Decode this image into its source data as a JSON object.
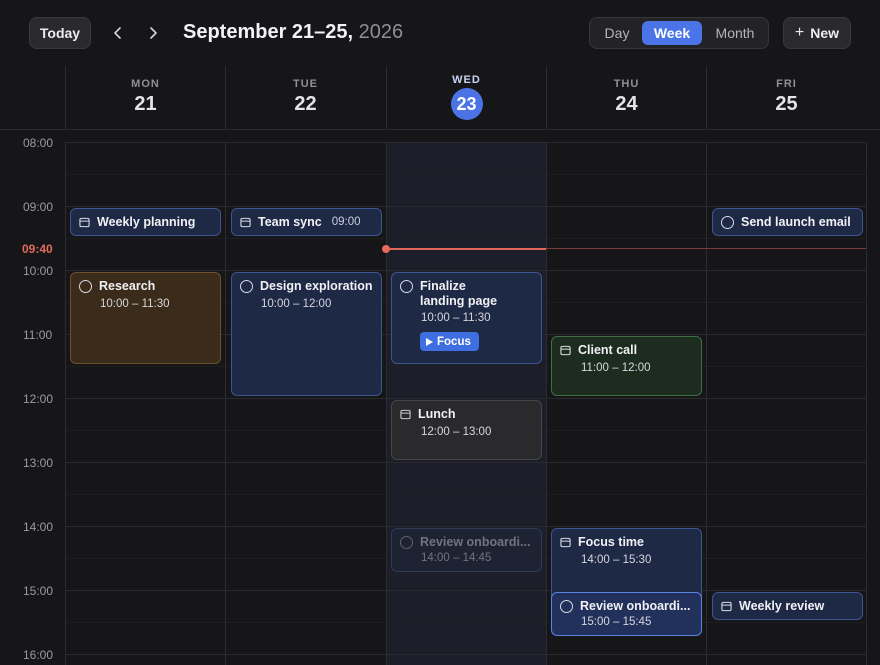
{
  "header": {
    "today_label": "Today",
    "title_range": "September 21–25,",
    "title_year": "2026",
    "views": [
      "Day",
      "Week",
      "Month"
    ],
    "active_view": "Week",
    "new_label": "New"
  },
  "days": [
    {
      "dow": "MON",
      "num": "21"
    },
    {
      "dow": "TUE",
      "num": "22"
    },
    {
      "dow": "WED",
      "num": "23",
      "today": true
    },
    {
      "dow": "THU",
      "num": "24"
    },
    {
      "dow": "FRI",
      "num": "25"
    }
  ],
  "time_labels": [
    "08:00",
    "09:00",
    "10:00",
    "11:00",
    "12:00",
    "13:00",
    "14:00",
    "15:00",
    "16:00"
  ],
  "now_label": "09:40",
  "events": {
    "mon_weekly_planning": {
      "title": "Weekly planning"
    },
    "mon_research": {
      "title": "Research",
      "time": "10:00 – 11:30"
    },
    "tue_team_sync": {
      "title": "Team sync",
      "time": "09:00"
    },
    "tue_design": {
      "title": "Design exploration",
      "time": "10:00 – 12:00"
    },
    "wed_finalize": {
      "title_line1": "Finalize",
      "title_line2": "landing page",
      "time": "10:00 – 11:30",
      "badge": "Focus"
    },
    "wed_lunch": {
      "title": "Lunch",
      "time": "12:00 – 13:00"
    },
    "wed_review": {
      "title": "Review onboardi...",
      "time": "14:00 – 14:45"
    },
    "thu_client": {
      "title": "Client call",
      "time": "11:00 – 12:00"
    },
    "thu_focus": {
      "title": "Focus time",
      "time": "14:00 – 15:30"
    },
    "thu_review": {
      "title": "Review onboardi...",
      "time": "15:00 – 15:45"
    },
    "fri_send": {
      "title": "Send launch email"
    },
    "fri_weekly_review": {
      "title": "Weekly review"
    }
  },
  "colors": {
    "accent": "#4a74e8",
    "now": "#e26a5e",
    "event_blue": "#1d2945",
    "event_brown": "#3a2b1a",
    "event_green": "#1c2d1f",
    "event_gray": "#2a2a2d"
  }
}
